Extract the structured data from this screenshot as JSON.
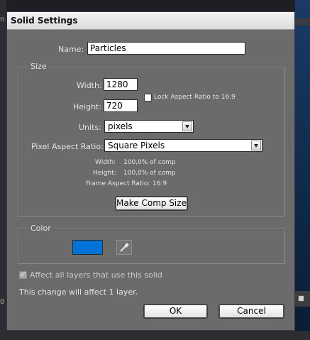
{
  "dialog": {
    "title": "Solid Settings",
    "name_label": "Name:",
    "name_value": "Particles"
  },
  "size": {
    "legend": "Size",
    "width_label": "Width:",
    "width_value": "1280",
    "height_label": "Height:",
    "height_value": "720",
    "lock_label": "Lock Aspect Ratio to 16:9",
    "lock_checked": false,
    "units_label": "Units:",
    "units_value": "pixels",
    "par_label": "Pixel Aspect Ratio:",
    "par_value": "Square Pixels",
    "info_width_label": "Width:",
    "info_width_value": "100,0% of comp",
    "info_height_label": "Height:",
    "info_height_value": "100,0% of comp",
    "info_far_label": "Frame Aspect Ratio:",
    "info_far_value": "16:9",
    "make_comp_size": "Make Comp Size"
  },
  "color": {
    "legend": "Color",
    "swatch_color": "#0072d8",
    "eyedropper_icon": "eyedropper-icon"
  },
  "footer": {
    "affect_label": "Affect all layers that use this solid",
    "affect_checked": true,
    "change_note": "This change will affect 1 layer.",
    "ok": "OK",
    "cancel": "Cancel"
  },
  "background": {
    "left_fragment": "n",
    "bottom_fragment": "0"
  }
}
